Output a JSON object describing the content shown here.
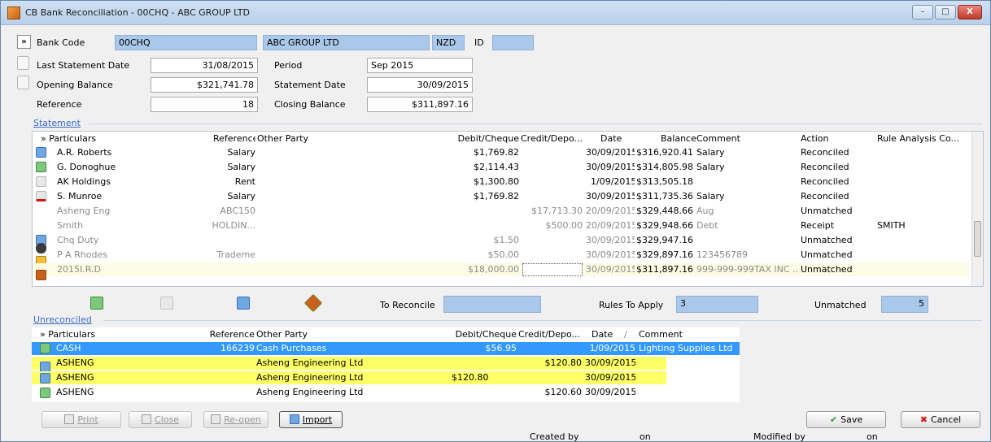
{
  "window": {
    "title": "CB Bank Reconciliation - 00CHQ - ABC GROUP LTD",
    "controls": {
      "minimize": "–",
      "maximize": "□",
      "close": "X"
    }
  },
  "header": {
    "expand_label": "»",
    "bank_code_label": "Bank Code",
    "bank_code": "00CHQ",
    "bank_name": "ABC GROUP LTD",
    "currency": "NZD",
    "id_label": "ID",
    "id_value": "",
    "last_statement_date_label": "Last Statement Date",
    "last_statement_date": "31/08/2015",
    "period_label": "Period",
    "period": "Sep 2015",
    "opening_balance_label": "Opening Balance",
    "opening_balance": "$321,741.78",
    "statement_date_label": "Statement Date",
    "statement_date": "30/09/2015",
    "reference_label": "Reference",
    "reference": "18",
    "closing_balance_label": "Closing Balance",
    "closing_balance": "$311,897.16"
  },
  "statement": {
    "group_label": "Statement",
    "columns": [
      "» Particulars",
      "Reference",
      "Other Party",
      "Debit/Cheque",
      "Credit/Depo...",
      "Date",
      "Balance",
      "Comment",
      "Action",
      "Rule Analysis Co..."
    ],
    "rows": [
      {
        "particulars": "A.R. Roberts",
        "reference": "Salary",
        "other_party": "",
        "debit": "$1,769.82",
        "credit": "",
        "date": "30/09/2015",
        "balance": "$316,920.41",
        "comment": "Salary",
        "action": "Reconciled",
        "rule": ""
      },
      {
        "particulars": "G. Donoghue",
        "reference": "Salary",
        "other_party": "",
        "debit": "$2,114.43",
        "credit": "",
        "date": "30/09/2015",
        "balance": "$314,805.98",
        "comment": "Salary",
        "action": "Reconciled",
        "rule": ""
      },
      {
        "particulars": "AK Holdings",
        "reference": "Rent",
        "other_party": "",
        "debit": "$1,300.80",
        "credit": "",
        "date": "1/09/2015",
        "balance": "$313,505.18",
        "comment": "",
        "action": "Reconciled",
        "rule": ""
      },
      {
        "particulars": "S. Munroe",
        "reference": "Salary",
        "other_party": "",
        "debit": "$1,769.82",
        "credit": "",
        "date": "30/09/2015",
        "balance": "$311,735.36",
        "comment": "Salary",
        "action": "Reconciled",
        "rule": ""
      },
      {
        "particulars": "Asheng Eng",
        "reference": "ABC150",
        "other_party": "",
        "debit": "",
        "credit": "$17,713.30",
        "date": "20/09/2015",
        "balance": "$329,448.66",
        "comment": "Aug",
        "action": "Unmatched",
        "rule": ""
      },
      {
        "particulars": "Smith",
        "reference": "HOLDIN...",
        "other_party": "",
        "debit": "",
        "credit": "$500.00",
        "date": "20/09/2015",
        "balance": "$329,948.66",
        "comment": "Debt",
        "action": "Receipt",
        "rule": "SMITH"
      },
      {
        "particulars": "Chq Duty",
        "reference": "",
        "other_party": "",
        "debit": "$1.50",
        "credit": "",
        "date": "30/09/2015",
        "balance": "$329,947.16",
        "comment": "",
        "action": "Unmatched",
        "rule": ""
      },
      {
        "particulars": "P A Rhodes",
        "reference": "Trademe",
        "other_party": "",
        "debit": "$50.00",
        "credit": "",
        "date": "30/09/2015",
        "balance": "$329,897.16",
        "comment": "123456789",
        "action": "Unmatched",
        "rule": ""
      },
      {
        "particulars": "2015I.R.D",
        "reference": "",
        "other_party": "",
        "debit": "$18,000.00",
        "credit": "",
        "date": "30/09/2015",
        "balance": "$311,897.16",
        "comment": "999-999-999TAX INC ...",
        "action": "Unmatched",
        "rule": ""
      }
    ]
  },
  "summary": {
    "to_reconcile_label": "To Reconcile",
    "to_reconcile": "",
    "rules_to_apply_label": "Rules To Apply",
    "rules_to_apply": "3",
    "unmatched_label": "Unmatched",
    "unmatched": "5"
  },
  "unreconciled": {
    "group_label": "Unreconciled",
    "columns": [
      "» Particulars",
      "Reference",
      "Other Party",
      "Debit/Cheque",
      "Credit/Depo...",
      "Date",
      "Comment"
    ],
    "sort_indicator": "∕",
    "rows": [
      {
        "particulars": "CASH",
        "reference": "166239",
        "other_party": "Cash Purchases",
        "debit": "$56.95",
        "credit": "",
        "date": "1/09/2015",
        "comment": "Lighting Supplies Ltd"
      },
      {
        "particulars": "ASHENG",
        "reference": "",
        "other_party": "Asheng Engineering Ltd",
        "debit": "",
        "credit": "$120.80",
        "date": "30/09/2015",
        "comment": ""
      },
      {
        "particulars": "ASHENG",
        "reference": "",
        "other_party": "Asheng Engineering Ltd",
        "debit": "$120.80",
        "credit": "",
        "date": "30/09/2015",
        "comment": ""
      },
      {
        "particulars": "ASHENG",
        "reference": "",
        "other_party": "Asheng Engineering Ltd",
        "debit": "",
        "credit": "$120.60",
        "date": "30/09/2015",
        "comment": ""
      }
    ]
  },
  "footer": {
    "print_label": "Print",
    "close_label": "Close",
    "reopen_label": "Re-open",
    "import_label": "Import",
    "save_label": "Save",
    "cancel_label": "Cancel",
    "created_by_label": "Created by",
    "created_on_label": "on",
    "modified_by_label": "Modified by",
    "modified_on_label": "on"
  },
  "colors": {
    "readonly_field": "#aac8e9",
    "selected_row": "#3399ff",
    "highlight_yellow": "#ffff66",
    "current_row": "#fcfbe3",
    "save_check": "#2f9e2f",
    "cancel_x": "#d01818"
  }
}
